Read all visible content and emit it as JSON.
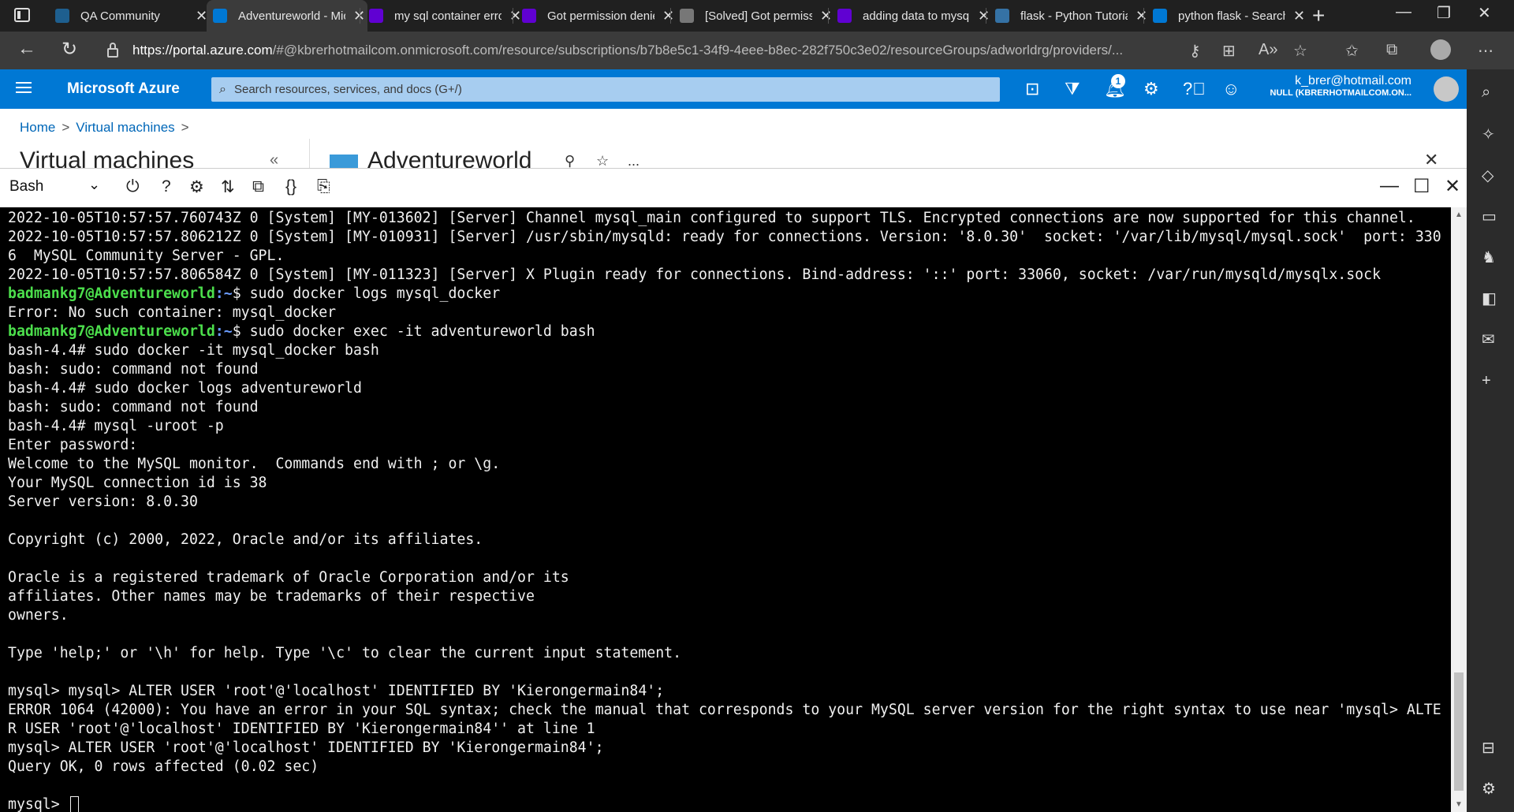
{
  "browser": {
    "tabs": [
      {
        "title": "QA Community",
        "icon": "qa-icon",
        "color": "#1e5f8f"
      },
      {
        "title": "Adventureworld - Microsoft Azure",
        "icon": "azure-icon",
        "color": "#0078d4"
      },
      {
        "title": "my sql container error",
        "icon": "yahoo-icon",
        "color": "#6001d2"
      },
      {
        "title": "Got permission denied",
        "icon": "yahoo-icon",
        "color": "#6001d2"
      },
      {
        "title": "[Solved] Got permission",
        "icon": "page-icon",
        "color": "#777777"
      },
      {
        "title": "adding data to mysql",
        "icon": "yahoo-icon",
        "color": "#6001d2"
      },
      {
        "title": "flask - Python Tutorial",
        "icon": "python-icon",
        "color": "#3572a5"
      },
      {
        "title": "python flask - Search",
        "icon": "search-icon",
        "color": "#0078d4"
      }
    ],
    "url_host": "https://portal.azure.com",
    "url_path": "/#@kbrerhotmailcom.onmicrosoft.com/resource/subscriptions/b7b8e5c1-34f9-4eee-b8ec-282f750c3e02/resourceGroups/adworldrg/providers/..."
  },
  "azure": {
    "brand": "Microsoft Azure",
    "search_placeholder": "Search resources, services, and docs (G+/)",
    "notifications_count": "1",
    "account_email": "k_brer@hotmail.com",
    "account_directory": "NULL (KBRERHOTMAILCOM.ON..."
  },
  "portal": {
    "breadcrumb": [
      "Home",
      "Virtual machines"
    ],
    "left_title": "Virtual machines",
    "resource_title": "Adventureworld",
    "more_label": "..."
  },
  "shell": {
    "type": "Bash",
    "lines": [
      {
        "text": "2022-10-05T10:57:57.760743Z 0 [System] [MY-013602] [Server] Channel mysql_main configured to support TLS. Encrypted connections are now supported for this channel."
      },
      {
        "text": "2022-10-05T10:57:57.806212Z 0 [System] [MY-010931] [Server] /usr/sbin/mysqld: ready for connections. Version: '8.0.30'  socket: '/var/lib/mysql/mysql.sock'  port: 330"
      },
      {
        "text": "6  MySQL Community Server - GPL."
      },
      {
        "text": "2022-10-05T10:57:57.806584Z 0 [System] [MY-011323] [Server] X Plugin ready for connections. Bind-address: '::' port: 33060, socket: /var/run/mysqld/mysqlx.sock"
      },
      {
        "user": "badmankg7@Adventureworld",
        "path": ":~",
        "text": "$ sudo docker logs mysql_docker"
      },
      {
        "text": "Error: No such container: mysql_docker"
      },
      {
        "user": "badmankg7@Adventureworld",
        "path": ":~",
        "text": "$ sudo docker exec -it adventureworld bash"
      },
      {
        "text": "bash-4.4# sudo docker -it mysql_docker bash"
      },
      {
        "text": "bash: sudo: command not found"
      },
      {
        "text": "bash-4.4# sudo docker logs adventureworld"
      },
      {
        "text": "bash: sudo: command not found"
      },
      {
        "text": "bash-4.4# mysql -uroot -p"
      },
      {
        "text": "Enter password:"
      },
      {
        "text": "Welcome to the MySQL monitor.  Commands end with ; or \\g."
      },
      {
        "text": "Your MySQL connection id is 38"
      },
      {
        "text": "Server version: 8.0.30"
      },
      {
        "text": ""
      },
      {
        "text": "Copyright (c) 2000, 2022, Oracle and/or its affiliates."
      },
      {
        "text": ""
      },
      {
        "text": "Oracle is a registered trademark of Oracle Corporation and/or its"
      },
      {
        "text": "affiliates. Other names may be trademarks of their respective"
      },
      {
        "text": "owners."
      },
      {
        "text": ""
      },
      {
        "text": "Type 'help;' or '\\h' for help. Type '\\c' to clear the current input statement."
      },
      {
        "text": ""
      },
      {
        "text": "mysql> mysql> ALTER USER 'root'@'localhost' IDENTIFIED BY 'Kierongermain84';"
      },
      {
        "text": "ERROR 1064 (42000): You have an error in your SQL syntax; check the manual that corresponds to your MySQL server version for the right syntax to use near 'mysql> ALTE"
      },
      {
        "text": "R USER 'root'@'localhost' IDENTIFIED BY 'Kierongermain84'' at line 1"
      },
      {
        "text": "mysql> ALTER USER 'root'@'localhost' IDENTIFIED BY 'Kierongermain84';"
      },
      {
        "text": "Query OK, 0 rows affected (0.02 sec)"
      },
      {
        "text": ""
      },
      {
        "text": "mysql> ",
        "cursor": true
      }
    ]
  }
}
